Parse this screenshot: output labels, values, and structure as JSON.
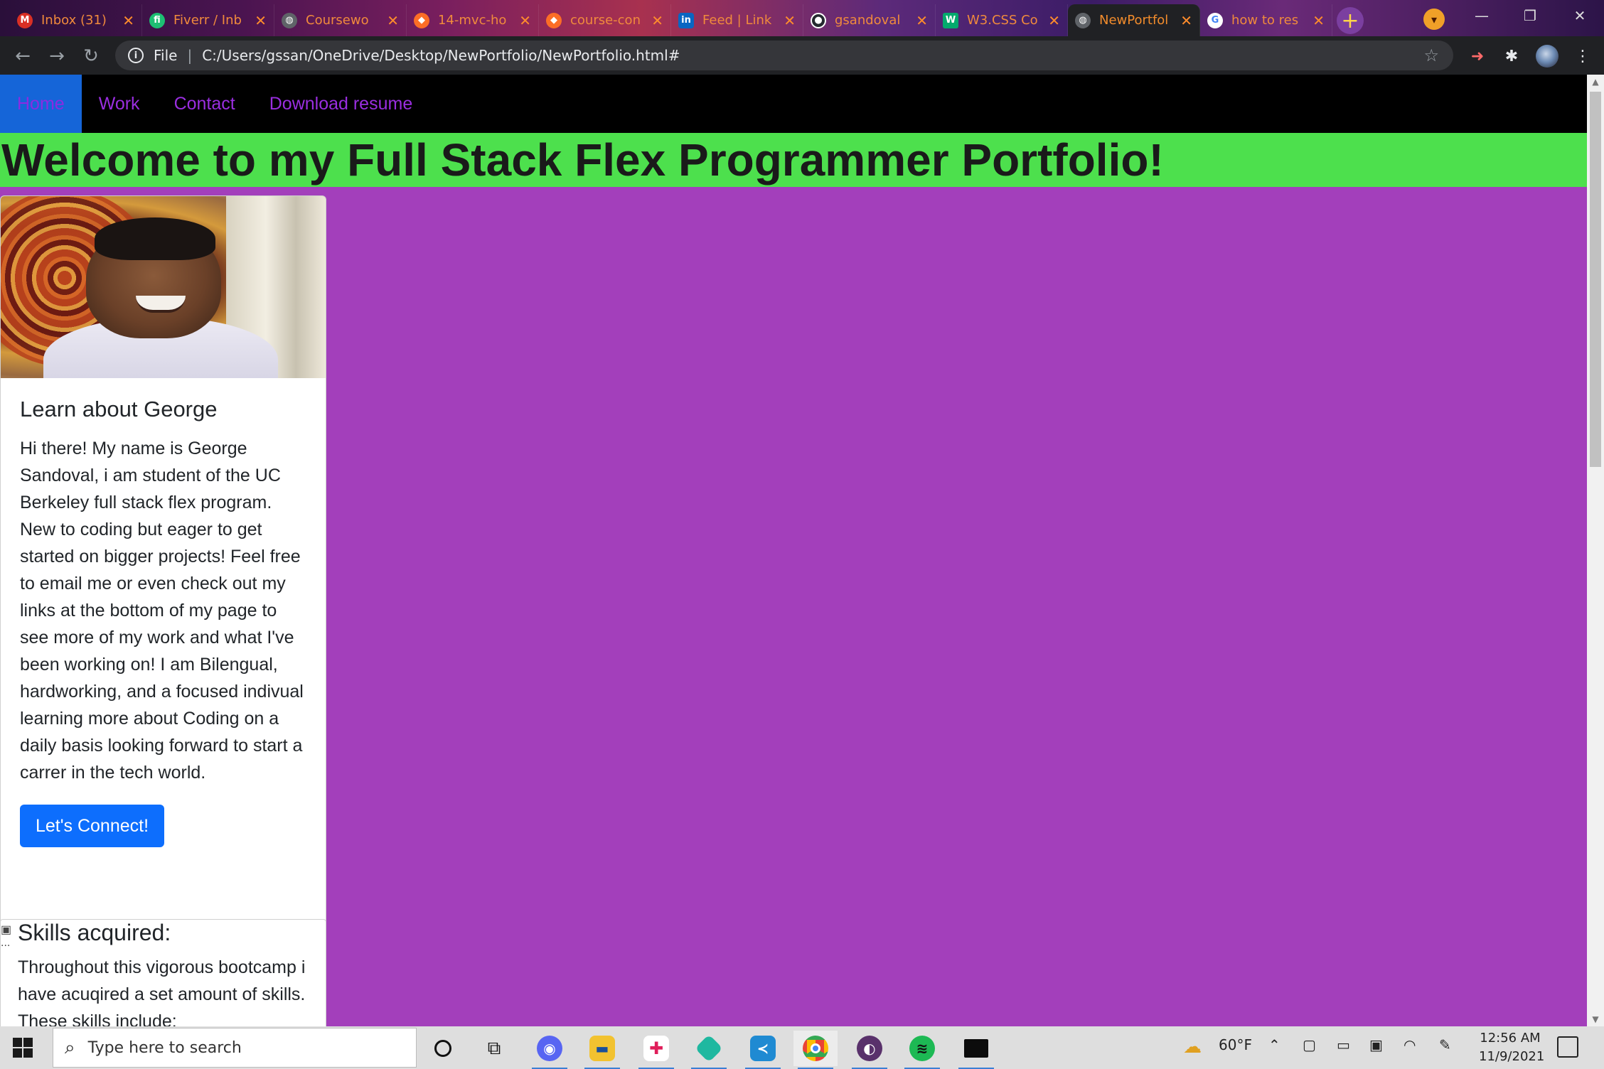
{
  "browser": {
    "tabs": [
      {
        "title": "Inbox (31)",
        "icon": "gmail-icon",
        "color": "#d93025"
      },
      {
        "title": "Fiverr / Inb",
        "icon": "fiverr-icon",
        "color": "#1dbf73"
      },
      {
        "title": "Coursewo",
        "icon": "globe-icon",
        "color": "#5f6368"
      },
      {
        "title": "14-mvc-ho",
        "icon": "gitlab-icon",
        "color": "#fc6d26"
      },
      {
        "title": "course-con",
        "icon": "gitlab-icon",
        "color": "#fc6d26"
      },
      {
        "title": "Feed | Link",
        "icon": "linkedin-icon",
        "color": "#0a66c2"
      },
      {
        "title": "gsandoval",
        "icon": "github-icon",
        "color": "#24292f"
      },
      {
        "title": "W3.CSS Co",
        "icon": "w3schools-icon",
        "color": "#04aa6d"
      },
      {
        "title": "NewPortfol",
        "icon": "globe-icon",
        "color": "#5f6368",
        "active": true
      },
      {
        "title": "how to res",
        "icon": "google-icon",
        "color": "#4285f4"
      }
    ],
    "address": {
      "scheme": "File",
      "url": "C:/Users/gssan/OneDrive/Desktop/NewPortfolio/NewPortfolio.html#"
    }
  },
  "page": {
    "nav": {
      "home": "Home",
      "work": "Work",
      "contact": "Contact",
      "resume": "Download resume"
    },
    "hero_title": "Welcome to my Full Stack Flex Programmer Portfolio!",
    "about": {
      "title": "Learn about George",
      "text": "Hi there! My name is George Sandoval, i am student of the UC Berkeley full stack flex program. New to coding but eager to get started on bigger projects! Feel free to email me or even check out my links at the bottom of my page to see more of my work and what I've been working on! I am Bilengual, hardworking, and a focused indivual learning more about Coding on a daily basis looking forward to start a carrer in the tech world.",
      "button": "Let's Connect!"
    },
    "skills": {
      "image_alt": "...",
      "title": "Skills acquired:",
      "text": "Throughout this vigorous bootcamp i have acuqired a set amount of skills. These skills include:"
    },
    "colors": {
      "background": "#a33fbb",
      "hero": "#4de04d",
      "nav": "#000000",
      "link": "#9a2ee0",
      "button": "#0d6efd"
    }
  },
  "taskbar": {
    "search_placeholder": "Type here to search",
    "weather": "60°F",
    "time": "12:56 AM",
    "date": "11/9/2021",
    "apps": [
      "cortana-icon",
      "task-view-icon",
      "discord-icon",
      "file-explorer-icon",
      "slack-icon",
      "gitkraken-icon",
      "vscode-icon",
      "chrome-icon",
      "tor-icon",
      "spotify-icon",
      "terminal-icon"
    ]
  }
}
